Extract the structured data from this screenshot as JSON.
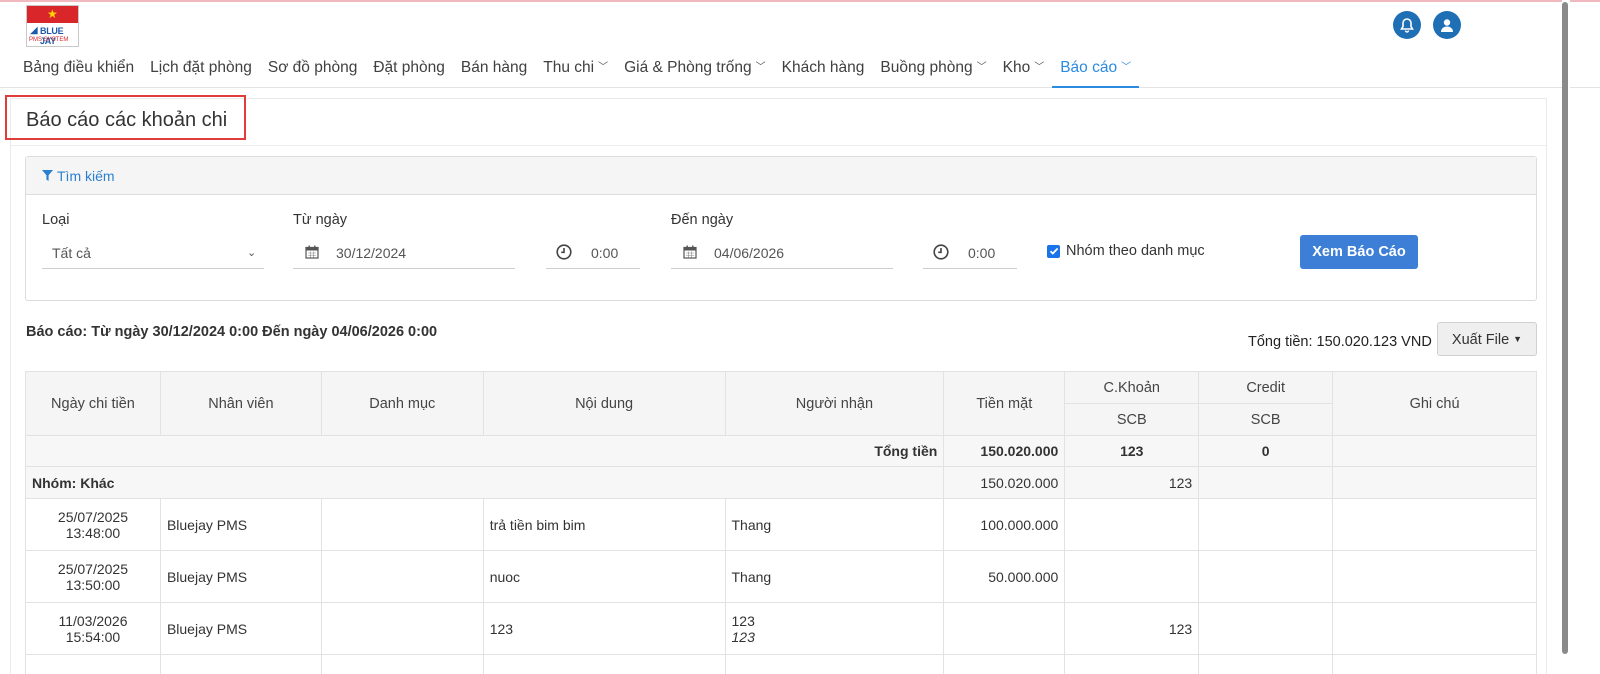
{
  "brand": {
    "logo_text": "BLUE JAY",
    "logo_sub": "PMS SYSTEM"
  },
  "icons": {
    "bell": "bell-icon",
    "user": "user-icon",
    "filter": "filter-icon",
    "calendar": "calendar-icon",
    "clock": "clock-icon"
  },
  "colors": {
    "accent": "#2b8be0",
    "primary_button": "#3d7fd6",
    "title_highlight": "#e03c3c"
  },
  "nav": [
    {
      "label": "Bảng điều khiển",
      "dropdown": false
    },
    {
      "label": "Lịch đặt phòng",
      "dropdown": false
    },
    {
      "label": "Sơ đồ phòng",
      "dropdown": false
    },
    {
      "label": "Đặt phòng",
      "dropdown": false
    },
    {
      "label": "Bán hàng",
      "dropdown": false
    },
    {
      "label": "Thu chi",
      "dropdown": true
    },
    {
      "label": "Giá & Phòng trống",
      "dropdown": true
    },
    {
      "label": "Khách hàng",
      "dropdown": false
    },
    {
      "label": "Buồng phòng",
      "dropdown": true
    },
    {
      "label": "Kho",
      "dropdown": true
    },
    {
      "label": "Báo cáo",
      "dropdown": true,
      "active": true
    }
  ],
  "page": {
    "title": "Báo cáo các khoản chi"
  },
  "search": {
    "header": "Tìm kiếm",
    "type_label": "Loại",
    "type_value": "Tất cả",
    "from_label": "Từ ngày",
    "from_date": "30/12/2024",
    "from_time": "0:00",
    "to_label": "Đến ngày",
    "to_date": "04/06/2026",
    "to_time": "0:00",
    "group_label": "Nhóm theo danh mục",
    "group_checked": true,
    "view_button": "Xem Báo Cáo"
  },
  "report": {
    "range": "Báo cáo: Từ ngày 30/12/2024 0:00 Đến ngày 04/06/2026 0:00",
    "total": "Tổng tiền: 150.020.123 VND",
    "export_button": "Xuất File"
  },
  "table": {
    "headers": {
      "date": "Ngày chi tiền",
      "staff": "Nhân viên",
      "category": "Danh mục",
      "content": "Nội dung",
      "receiver": "Người nhận",
      "cash": "Tiền mặt",
      "transfer": "C.Khoản",
      "transfer_sub": "SCB",
      "credit": "Credit",
      "credit_sub": "SCB",
      "note": "Ghi chú"
    },
    "summary": {
      "label": "Tổng tiền",
      "cash": "150.020.000",
      "transfer": "123",
      "credit": "0"
    },
    "group": {
      "label": "Nhóm: Khác",
      "cash": "150.020.000",
      "transfer": "123"
    },
    "rows": [
      {
        "date": "25/07/2025",
        "time": "13:48:00",
        "staff": "Bluejay PMS",
        "category": "",
        "content": "trả tiền bim bim",
        "receiver": "Thang",
        "receiver_sub": "",
        "cash": "100.000.000",
        "transfer": "",
        "credit": "",
        "note": ""
      },
      {
        "date": "25/07/2025",
        "time": "13:50:00",
        "staff": "Bluejay PMS",
        "category": "",
        "content": "nuoc",
        "receiver": "Thang",
        "receiver_sub": "",
        "cash": "50.000.000",
        "transfer": "",
        "credit": "",
        "note": ""
      },
      {
        "date": "11/03/2026",
        "time": "15:54:00",
        "staff": "Bluejay PMS",
        "category": "",
        "content": "123",
        "receiver": "123",
        "receiver_sub": "123",
        "cash": "",
        "transfer": "123",
        "credit": "",
        "note": ""
      }
    ]
  }
}
